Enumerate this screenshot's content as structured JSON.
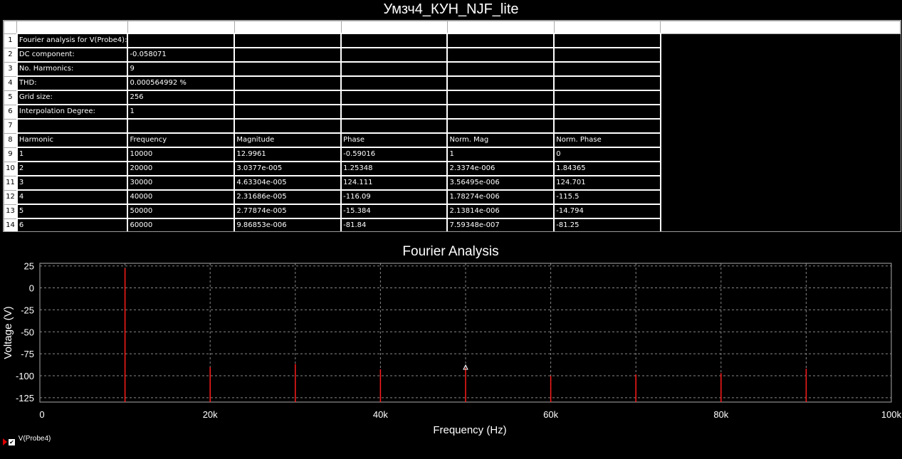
{
  "window_title": "Умзч4_КУН_NJF_lite",
  "grid": {
    "rows": [
      {
        "n": "1",
        "cells": [
          "Fourier analysis for V(Probe4):",
          "",
          "",
          "",
          "",
          ""
        ]
      },
      {
        "n": "2",
        "cells": [
          "DC component:",
          "-0.058071",
          "",
          "",
          "",
          ""
        ]
      },
      {
        "n": "3",
        "cells": [
          "No. Harmonics:",
          "9",
          "",
          "",
          "",
          ""
        ]
      },
      {
        "n": "4",
        "cells": [
          "THD:",
          "0.000564992 %",
          "",
          "",
          "",
          ""
        ]
      },
      {
        "n": "5",
        "cells": [
          "Grid size:",
          "256",
          "",
          "",
          "",
          ""
        ]
      },
      {
        "n": "6",
        "cells": [
          "Interpolation Degree:",
          "1",
          "",
          "",
          "",
          ""
        ]
      },
      {
        "n": "7",
        "cells": [
          "",
          "",
          "",
          "",
          "",
          ""
        ]
      },
      {
        "n": "8",
        "cells": [
          "Harmonic",
          "Frequency",
          "Magnitude",
          "Phase",
          "Norm. Mag",
          "Norm. Phase"
        ]
      },
      {
        "n": "9",
        "cells": [
          "1",
          "10000",
          "12.9961",
          "-0.59016",
          "1",
          "0"
        ]
      },
      {
        "n": "10",
        "cells": [
          "2",
          "20000",
          "3.0377e-005",
          "1.25348",
          "2.3374e-006",
          "1.84365"
        ]
      },
      {
        "n": "11",
        "cells": [
          "3",
          "30000",
          "4.63304e-005",
          "124.111",
          "3.56495e-006",
          "124.701"
        ]
      },
      {
        "n": "12",
        "cells": [
          "4",
          "40000",
          "2.31686e-005",
          "-116.09",
          "1.78274e-006",
          "-115.5"
        ]
      },
      {
        "n": "13",
        "cells": [
          "5",
          "50000",
          "2.77874e-005",
          "-15.384",
          "2.13814e-006",
          "-14.794"
        ]
      },
      {
        "n": "14",
        "cells": [
          "6",
          "60000",
          "9.86853e-006",
          "-81.84",
          "7.59348e-007",
          "-81.25"
        ]
      }
    ]
  },
  "chart_data": {
    "type": "bar",
    "title": "Fourier Analysis",
    "xlabel": "Frequency (Hz)",
    "ylabel": "Voltage (V)",
    "xlim": [
      0,
      100000
    ],
    "ylim": [
      -130,
      28
    ],
    "xticks": [
      0,
      20000,
      40000,
      60000,
      80000,
      100000
    ],
    "xtick_labels": [
      "0",
      "20k",
      "40k",
      "60k",
      "80k",
      "100k"
    ],
    "yticks": [
      25,
      0,
      -25,
      -50,
      -75,
      -100,
      -125
    ],
    "ytick_labels": [
      "25",
      "0",
      "-25",
      "-50",
      "-75",
      "-100",
      "-125"
    ],
    "grid": true,
    "series": [
      {
        "name": "V(Probe4)",
        "color": "#ff1a1a",
        "x": [
          10000,
          20000,
          30000,
          40000,
          50000,
          60000,
          70000,
          80000,
          90000
        ],
        "y": [
          22.3,
          -90.3,
          -86.7,
          -92.7,
          -91.1,
          -100.1,
          -98.5,
          -97.0,
          -92.0
        ]
      }
    ],
    "marker": {
      "x": 50000,
      "y": -91.1
    }
  },
  "legend": {
    "label": "V(Probe4)"
  }
}
